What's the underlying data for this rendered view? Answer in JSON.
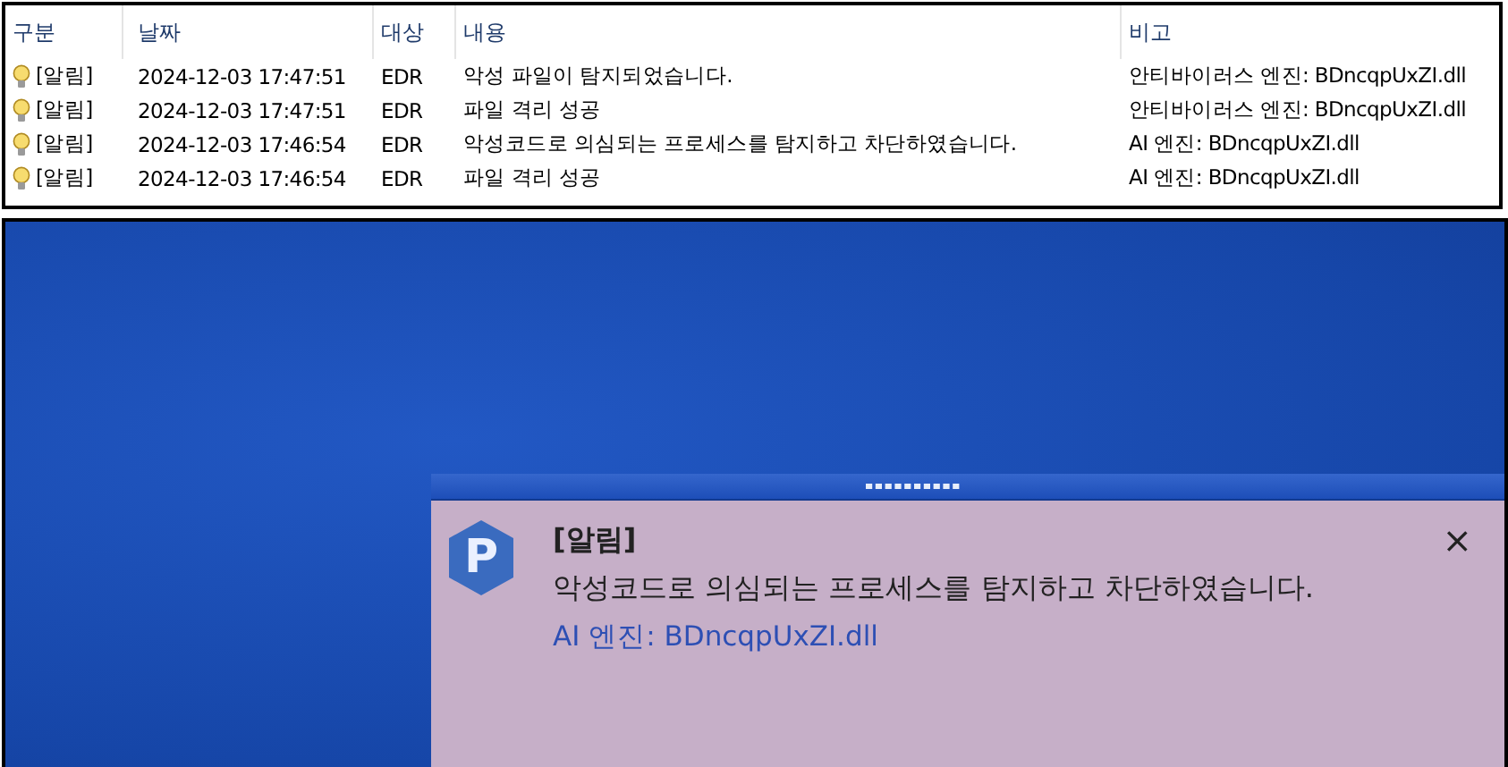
{
  "log_table": {
    "columns": [
      "구분",
      "날짜",
      "대상",
      "내용",
      "비고"
    ],
    "rows": [
      {
        "type": "[알림]",
        "date": "2024-12-03 17:47:51",
        "target": "EDR",
        "content": "악성 파일이 탐지되었습니다.",
        "note": "안티바이러스 엔진: BDncqpUxZI.dll"
      },
      {
        "type": "[알림]",
        "date": "2024-12-03 17:47:51",
        "target": "EDR",
        "content": "파일 격리 성공",
        "note": "안티바이러스 엔진: BDncqpUxZI.dll"
      },
      {
        "type": "[알림]",
        "date": "2024-12-03 17:46:54",
        "target": "EDR",
        "content": "악성코드로 의심되는 프로세스를 탐지하고 차단하였습니다.",
        "note": "AI 엔진: BDncqpUxZI.dll"
      },
      {
        "type": "[알림]",
        "date": "2024-12-03 17:46:54",
        "target": "EDR",
        "content": "파일 격리 성공",
        "note": "AI 엔진: BDncqpUxZI.dll"
      }
    ]
  },
  "notification": {
    "logo_letter": "P",
    "title": "[알림]",
    "message": "악성코드로 의심되는 프로세스를 탐지하고 차단하였습니다.",
    "detail": "AI 엔진: BDncqpUxZI.dll",
    "close": "×"
  }
}
